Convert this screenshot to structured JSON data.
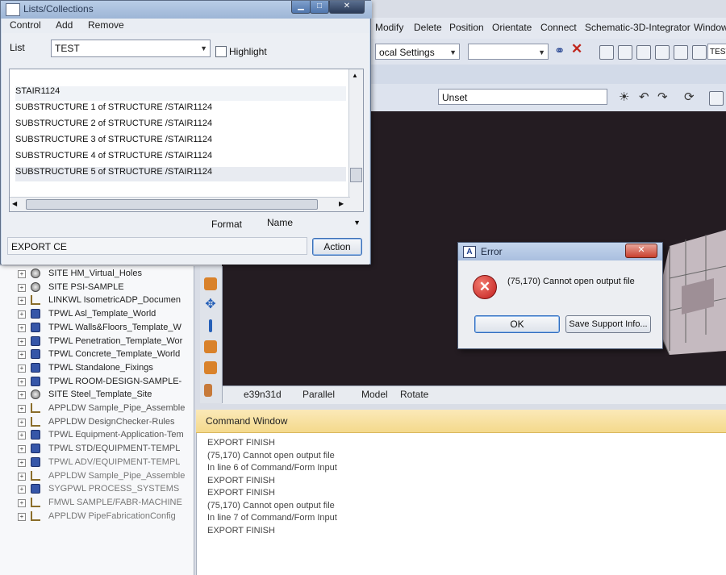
{
  "app_menu": {
    "items": [
      "Modify",
      "Delete",
      "Position",
      "Orientate",
      "Connect",
      "Schematic-3D-Integrator",
      "Window"
    ]
  },
  "toolbar": {
    "settings_combo": "ocal Settings",
    "project_combo": "TEST",
    "unset_combo": "Unset"
  },
  "list_window": {
    "title": "Lists/Collections",
    "menu": [
      "Control",
      "Add",
      "Remove"
    ],
    "list_label": "List",
    "list_value": "TEST",
    "highlight_label": "Highlight",
    "items": [
      "STAIR1124",
      "SUBSTRUCTURE 1 of STRUCTURE /STAIR1124",
      "SUBSTRUCTURE 2 of STRUCTURE /STAIR1124",
      "SUBSTRUCTURE 3 of STRUCTURE /STAIR1124",
      "SUBSTRUCTURE 4 of STRUCTURE /STAIR1124",
      "SUBSTRUCTURE 5 of STRUCTURE /STAIR1124"
    ],
    "format_label": "Format",
    "format_value": "Name",
    "command_text": "EXPORT CE",
    "action_label": "Action"
  },
  "explorer": {
    "rows": [
      "SITE HM_Virtual_Holes",
      "SITE PSI-SAMPLE",
      "LINKWL IsometricADP_Documen",
      "TPWL Asl_Template_World",
      "TPWL Walls&Floors_Template_W",
      "TPWL Penetration_Template_Wor",
      "TPWL Concrete_Template_World",
      "TPWL Standalone_Fixings",
      "TPWL ROOM-DESIGN-SAMPLE-",
      "SITE Steel_Template_Site",
      "APPLDW Sample_Pipe_Assemble",
      "APPLDW DesignChecker-Rules",
      "TPWL Equipment-Application-Tem",
      "TPWL STD/EQUIPMENT-TEMPL",
      "TPWL ADV/EQUIPMENT-TEMPL",
      "APPLDW Sample_Pipe_Assemble",
      "SYGPWL PROCESS_SYSTEMS",
      "FMWL SAMPLE/FABR-MACHINE",
      "APPLDW PipeFabricationConfig"
    ],
    "icons": [
      "globe-icon",
      "globe-icon",
      "tree-icon",
      "world-icon",
      "world-icon",
      "world-icon",
      "world-icon",
      "world-icon",
      "world-icon",
      "globe-icon",
      "tree-icon",
      "tree-icon",
      "world-icon",
      "world-icon",
      "world-icon",
      "tree-icon",
      "world-icon",
      "tree-icon",
      "tree-icon"
    ]
  },
  "viewport_status": {
    "view_name": "e39n31d",
    "projection": "Parallel",
    "mode": "Model",
    "action": "Rotate"
  },
  "command_window": {
    "title": "Command Window",
    "lines": [
      "EXPORT FINISH",
      "(75,170)  Cannot open output file",
      " In line 6 of Command/Form Input",
      "EXPORT FINISH",
      "EXPORT FINISH",
      "(75,170)  Cannot open output file",
      " In line 7 of Command/Form Input",
      "EXPORT FINISH"
    ]
  },
  "error_dialog": {
    "title": "Error",
    "message": "(75,170)  Cannot open output file",
    "ok_label": "OK",
    "support_label": "Save Support Info...",
    "close_label": "✕"
  },
  "colors": {
    "viewport_bg": "#241c22",
    "command_header": "#f4d98c",
    "error_red": "#d0282a"
  }
}
